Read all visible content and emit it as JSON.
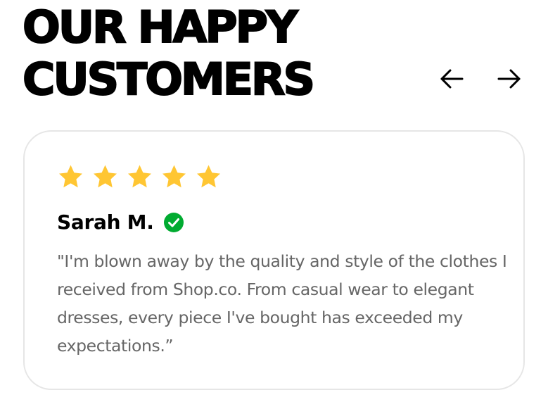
{
  "section": {
    "title_line1": "OUR HAPPY",
    "title_line2": "CUSTOMERS"
  },
  "navigation": {
    "prev_icon": "arrow-left-icon",
    "next_icon": "arrow-right-icon"
  },
  "review": {
    "rating": 5,
    "rating_max": 5,
    "star_color": "#FFC633",
    "reviewer_name": "Sarah M.",
    "verified_icon": "check-circle-icon",
    "verified_color": "#01AB31",
    "text": "\"I'm blown away by the quality and style of the clothes I received from Shop.co. From casual wear to elegant dresses, every piece I've bought has exceeded my expectations.”"
  }
}
